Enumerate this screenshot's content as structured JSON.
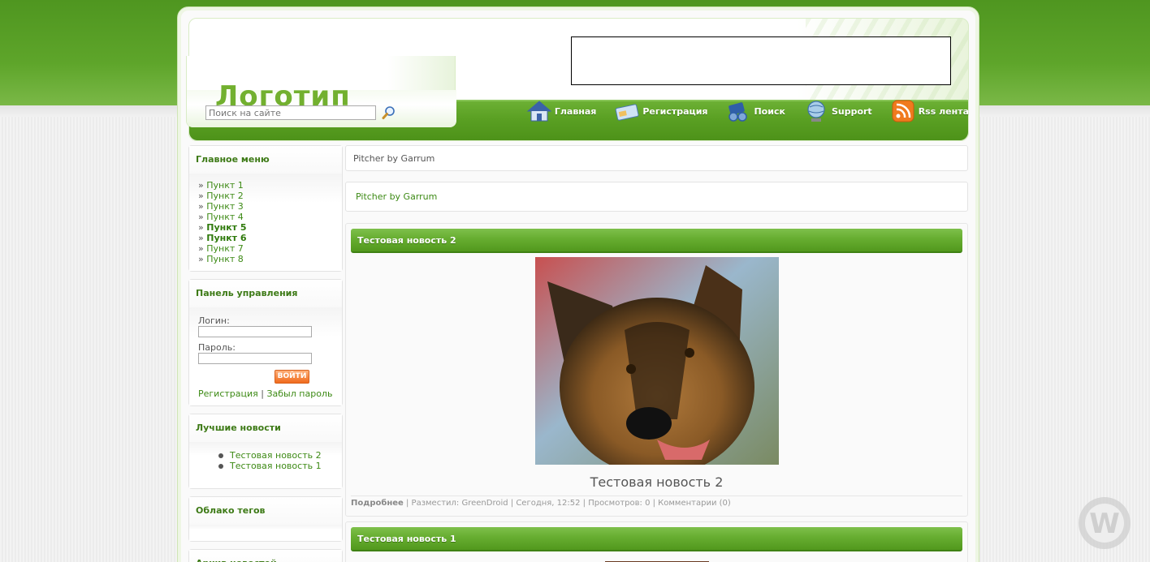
{
  "header": {
    "logo": "Логотип",
    "search_placeholder": "Поиск на сайте"
  },
  "nav": [
    {
      "label": "Главная",
      "icon": "home-icon"
    },
    {
      "label": "Регистрация",
      "icon": "registration-card-icon"
    },
    {
      "label": "Поиск",
      "icon": "binoculars-icon"
    },
    {
      "label": "Support",
      "icon": "globe-support-icon"
    },
    {
      "label": "Rss лента",
      "icon": "rss-icon"
    }
  ],
  "sidebar": {
    "main_menu": {
      "title": "Главное меню",
      "items": [
        "Пункт 1",
        "Пункт 2",
        "Пункт 3",
        "Пункт 4",
        "Пункт 5",
        "Пункт 6",
        "Пункт 7",
        "Пункт 8"
      ]
    },
    "control_panel": {
      "title": "Панель управления",
      "login_label": "Логин:",
      "password_label": "Пароль:",
      "login_button": "ВОЙТИ",
      "register_link": "Регистрация",
      "separator": "|",
      "forgot_link": "Забыл пароль"
    },
    "best_news": {
      "title": "Лучшие новости",
      "items": [
        "Тестовая новость 2",
        "Тестовая новость 1"
      ]
    },
    "tag_cloud": {
      "title": "Облако тегов"
    },
    "archive": {
      "title": "Архив новостей"
    }
  },
  "content": {
    "crumb": "Pitcher by Garrum",
    "crumb_link": "Pitcher by Garrum",
    "articles": [
      {
        "title": "Тестовая новость 2",
        "caption": "Тестовая новость 2",
        "more": "Подробнее",
        "meta": " | Разместил: GreenDroid | Сегодня, 12:52 | Просмотров: 0 | Комментарии (0)"
      },
      {
        "title": "Тестовая новость 1"
      }
    ]
  },
  "colors": {
    "brand_green": "#5aa023",
    "link_green": "#3d8a15",
    "logo_green": "#72b02f",
    "button_orange": "#f06a1c"
  }
}
